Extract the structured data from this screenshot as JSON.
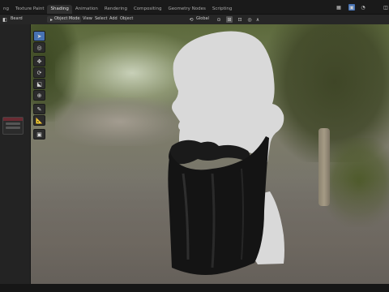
{
  "tabs": [
    {
      "label": "ng",
      "active": false
    },
    {
      "label": "Texture Paint",
      "active": false
    },
    {
      "label": "Shading",
      "active": true
    },
    {
      "label": "Animation",
      "active": false
    },
    {
      "label": "Rendering",
      "active": false
    },
    {
      "label": "Compositing",
      "active": false
    },
    {
      "label": "Geometry Nodes",
      "active": false
    },
    {
      "label": "Scripting",
      "active": false
    }
  ],
  "header": {
    "left_panel_label": "Beard",
    "mode": "Object Mode",
    "menus": [
      "View",
      "Select",
      "Add",
      "Object"
    ],
    "orientation": "Global"
  },
  "toolbar": {
    "tools": [
      "select-cursor-icon",
      "cursor-icon",
      "move-icon",
      "rotate-icon",
      "scale-icon",
      "transform-icon",
      "annotate-icon",
      "measure-icon",
      "add-cube-icon"
    ]
  },
  "colors": {
    "accent": "#4772b3",
    "bust": "#d9d9d9",
    "hair": "#141414"
  }
}
